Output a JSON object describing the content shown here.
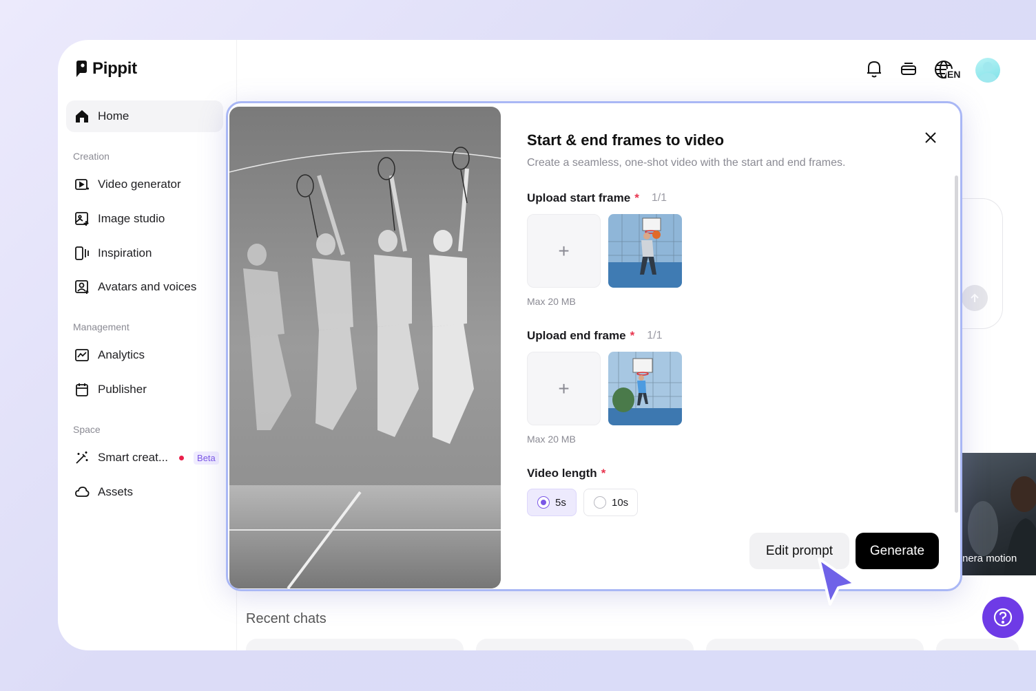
{
  "brand": {
    "name": "Pippit"
  },
  "sidebar": {
    "home": "Home",
    "sections": {
      "creation": "Creation",
      "management": "Management",
      "space": "Space"
    },
    "creation_items": [
      {
        "label": "Video generator",
        "icon": "video-generator-icon"
      },
      {
        "label": "Image studio",
        "icon": "image-studio-icon"
      },
      {
        "label": "Inspiration",
        "icon": "inspiration-icon"
      },
      {
        "label": "Avatars and voices",
        "icon": "avatar-voice-icon"
      }
    ],
    "management_items": [
      {
        "label": "Analytics",
        "icon": "analytics-icon"
      },
      {
        "label": "Publisher",
        "icon": "calendar-icon"
      }
    ],
    "space_items": [
      {
        "label": "Smart creat...",
        "icon": "magic-wand-icon",
        "badge": "Beta"
      },
      {
        "label": "Assets",
        "icon": "cloud-icon"
      }
    ]
  },
  "topbar": {
    "language": "EN"
  },
  "background": {
    "recent_chats": "Recent chats",
    "thumb_caption": "nera motion"
  },
  "modal": {
    "title": "Start & end frames to video",
    "subtitle": "Create a seamless, one-shot video with the start and end frames.",
    "start_frame": {
      "label": "Upload start frame",
      "required": "*",
      "count": "1/1",
      "max": "Max 20 MB"
    },
    "end_frame": {
      "label": "Upload end frame",
      "required": "*",
      "count": "1/1",
      "max": "Max 20 MB"
    },
    "video_length": {
      "label": "Video length",
      "required": "*",
      "options": [
        "5s",
        "10s"
      ],
      "selected": "5s"
    },
    "upload_plus": "+",
    "edit_prompt": "Edit prompt",
    "generate": "Generate"
  },
  "colors": {
    "accent": "#7b57e6",
    "help_button": "#6e3be6",
    "required": "#e8344e",
    "modal_border": "#a9b7f5"
  }
}
